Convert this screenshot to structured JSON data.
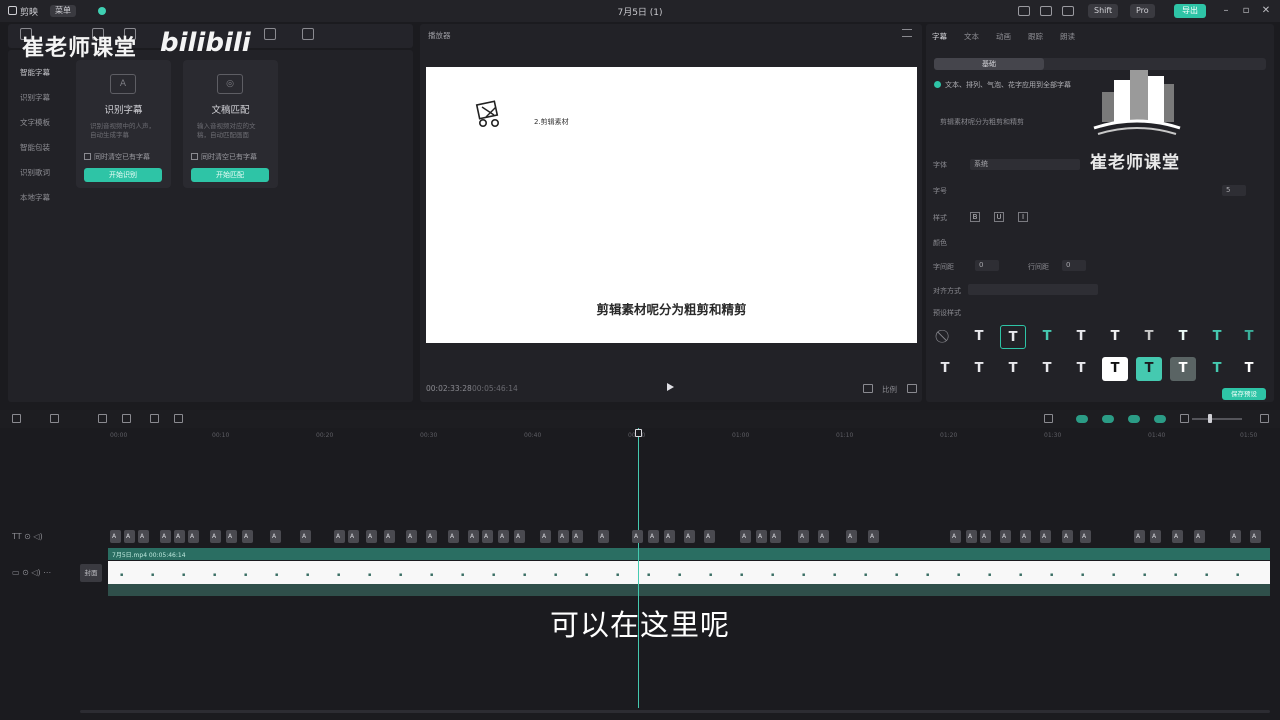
{
  "titlebar": {
    "app_name": "剪映",
    "menu": "菜单",
    "doc_title": "7月5日 (1)",
    "shortcut": "Shift",
    "plus": "Pro",
    "export": "导出"
  },
  "watermark": {
    "text": "崔老师课堂",
    "bili": "bilibili",
    "logo_text": "崔老师课堂"
  },
  "left_nav": {
    "items": [
      "智能字幕",
      "识别字幕",
      "文字模板",
      "智能包装",
      "识别歌词",
      "本地字幕"
    ]
  },
  "cards": [
    {
      "title": "识别字幕",
      "desc": "识别音视频中的人声，自动生成字幕",
      "check": "同时清空已有字幕",
      "button": "开始识别"
    },
    {
      "title": "文稿匹配",
      "desc": "输入音视频对应的文稿，自动匹配画面",
      "check": "同时清空已有字幕",
      "button": "开始匹配"
    }
  ],
  "preview": {
    "header": "播放器",
    "canvas_label": "2.剪辑素材",
    "canvas_caption": "剪辑素材呢分为粗剪和精剪",
    "time_current": "00:02:33:28",
    "time_total": "00:05:46:14",
    "ratio": "比例"
  },
  "right_panel": {
    "tabs": [
      "字幕",
      "文本",
      "动画",
      "跟踪",
      "朗读"
    ],
    "segment": "基础",
    "apply_all": "文本、排列、气泡、花字应用到全部字幕",
    "text_value": "剪辑素材呢分为粗剪和精剪",
    "labels": {
      "font": "字体",
      "size": "字号",
      "style": "样式",
      "color": "颜色",
      "char_spacing": "字间距",
      "line_spacing": "行间距",
      "align": "对齐方式",
      "preset": "预设样式"
    },
    "font_value": "系统",
    "size_value": "5",
    "char_spacing_value": "0",
    "line_spacing_value": "0",
    "save_preset": "保存预设"
  },
  "timeline": {
    "ticks": [
      "00:00",
      "00:10",
      "00:20",
      "00:30",
      "00:40",
      "00:50",
      "01:00",
      "01:10",
      "01:20",
      "01:30",
      "01:40",
      "01:50"
    ],
    "video_label": "7月5日.mp4  00:05:46:14",
    "cover": "封面"
  },
  "subtitle": "可以在这里呢",
  "colors": {
    "accent": "#2ec4a6",
    "background": "#1b1b1f",
    "panel": "#222227"
  }
}
